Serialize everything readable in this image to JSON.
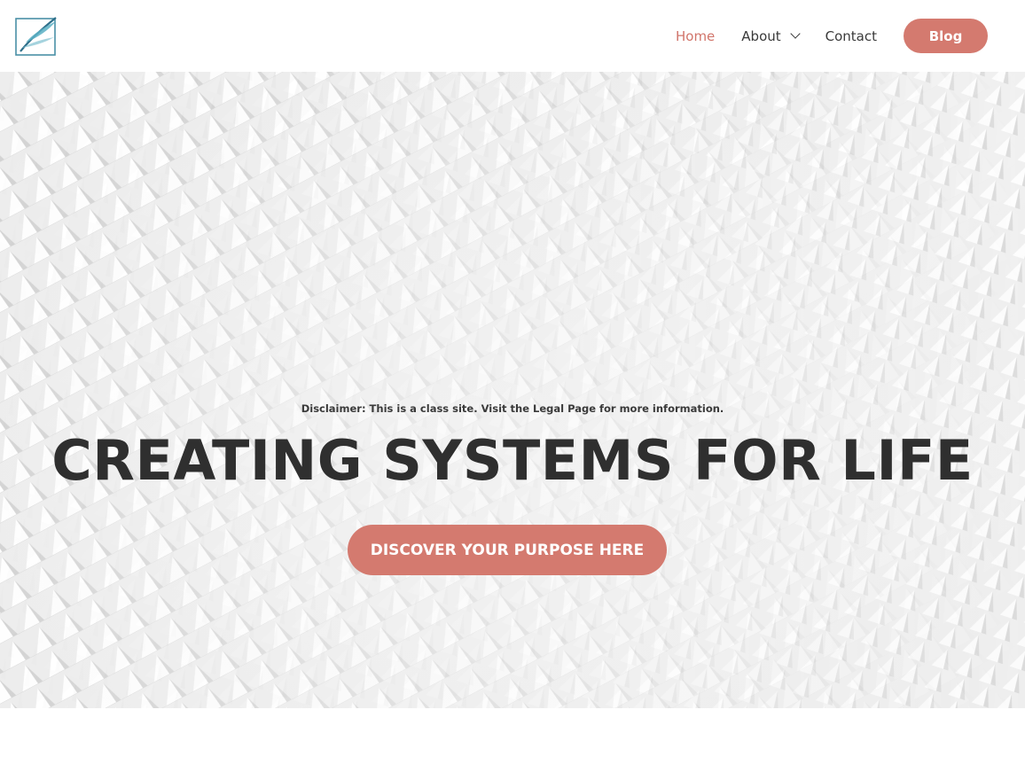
{
  "header": {
    "logo_icon": "feather-quill-logo",
    "nav": [
      {
        "label": "Home",
        "active": true
      },
      {
        "label": "About",
        "has_dropdown": true
      },
      {
        "label": "Contact"
      }
    ],
    "blog_button": "Blog"
  },
  "hero": {
    "background": "white-geometric-pattern-image",
    "disclaimer": "Disclaimer: This is a class site. Visit the Legal Page for more information.",
    "title": "CREATING SYSTEMS FOR LIFE",
    "cta_label": "DISCOVER YOUR PURPOSE HERE"
  },
  "colors": {
    "accent": "#d47a6f",
    "active_nav": "#d1756b",
    "text_dark": "#3a3a3a"
  }
}
